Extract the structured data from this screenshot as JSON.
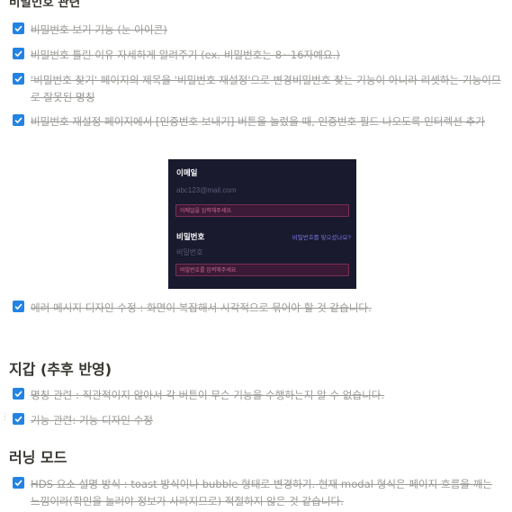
{
  "sections": {
    "password": {
      "heading": "비밀번호 관련",
      "items": [
        "비밀번호 보기 기능 (눈 아이콘)",
        "비밀번호 틀린 이유 자세하게 알려주기 (ex. 비밀번호는 8~16자예요.)",
        "'비밀번호 찾기' 페이지의 제목을 '비밀번호 재설정'으로 변경비밀번호 찾는 기능이 아니라 리셋하는 기능이므로 잘못된 명칭",
        "비밀번호 재설정 페이지에서 [인증번호 보내기] 버튼을 눌렀을 때, 인증번호 필드 나오도록 인터렉션 추가",
        "에러 메시지 디자인 수정 : 화면이 복잡해서 시각적으로 묶어야 할 것 같습니다."
      ]
    },
    "wallet": {
      "heading": "지갑 (추후 반영)",
      "items": [
        "명칭 관련 : 직관적이지 않아서 각 버튼이 무슨 기능을 수행하는지 알 수 없습니다.",
        "기능 관련: 기능 디자인 수정"
      ]
    },
    "learning": {
      "heading": "러닝 모드",
      "items": [
        "HDS 요소 설명 방식 : toast 방식이나 bubble 형태로 변경하기.   현재 modal 형식은 페이지 흐름을 깨는 느낌이라(확인을 눌러야 정보가 사라지므로) 적절하지 않은 것 같습니다."
      ]
    }
  },
  "screenshot": {
    "email_label": "이메일",
    "email_value": "abc123@mail.com",
    "email_error": "이메일을 입력해주세요.",
    "password_label": "비밀번호",
    "forgot_link": "비밀번호를 잊으셨나요?",
    "password_placeholder": "비밀번호",
    "password_error": "비밀번호를 입력해주세요."
  },
  "colors": {
    "checkbox": "#2383e2",
    "done_text": "#9b9a97",
    "screenshot_bg": "#191a2e",
    "error_bg": "#3a1a36"
  }
}
